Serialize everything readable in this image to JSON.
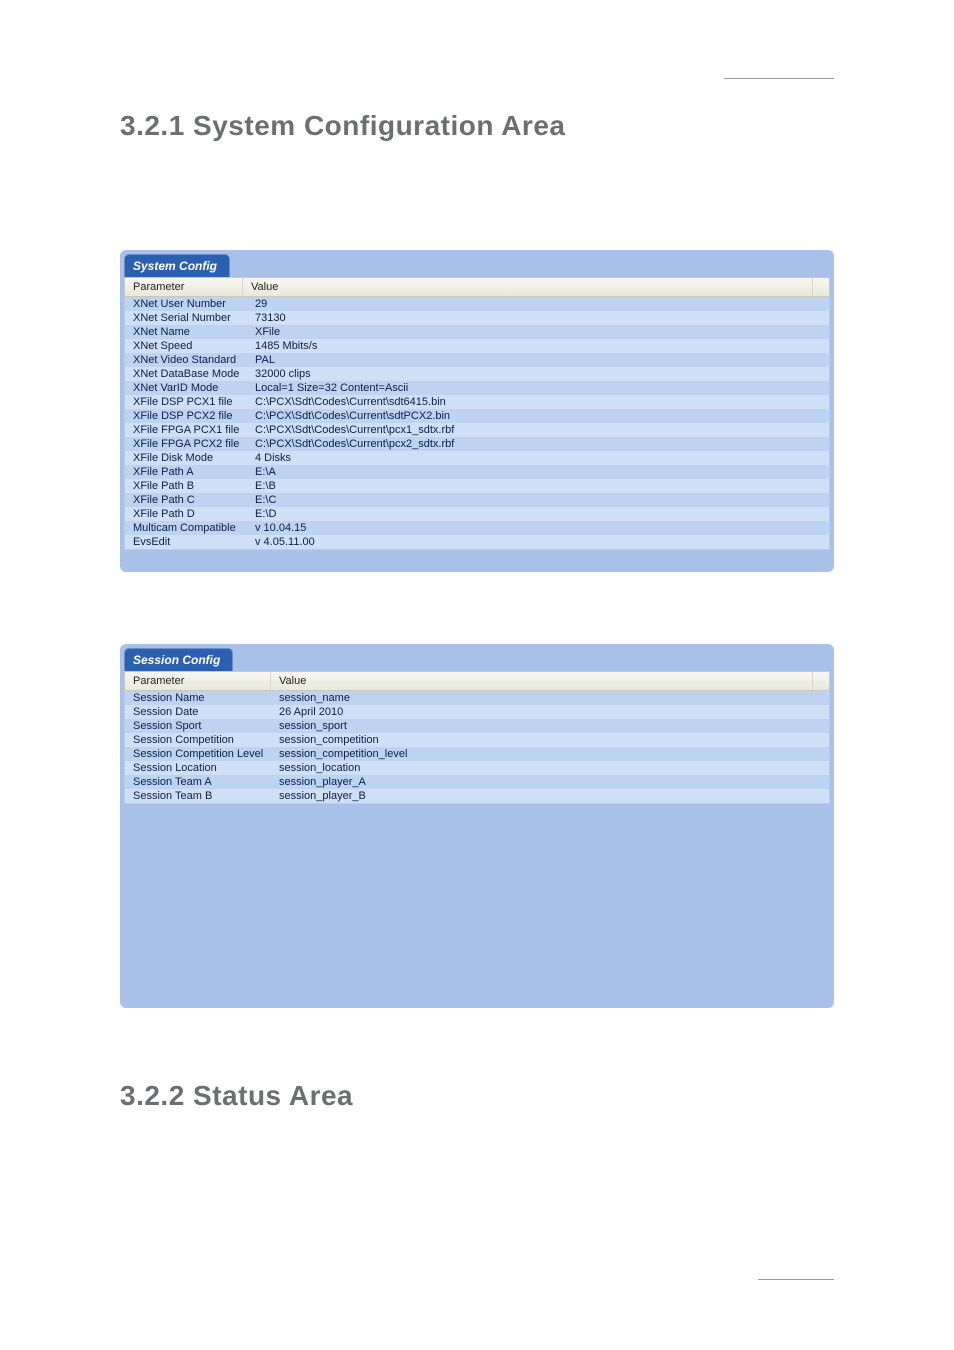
{
  "headings": {
    "system_config": "3.2.1  System  Configuration  Area",
    "status_area": "3.2.2  Status  Area"
  },
  "system_panel": {
    "tab_label": "System Config",
    "columns": {
      "param": "Parameter",
      "value": "Value"
    },
    "rows": [
      {
        "param": "XNet User Number",
        "value": "29"
      },
      {
        "param": "XNet Serial Number",
        "value": "73130"
      },
      {
        "param": "XNet Name",
        "value": "XFile"
      },
      {
        "param": "XNet Speed",
        "value": "1485 Mbits/s"
      },
      {
        "param": "XNet Video Standard",
        "value": "PAL"
      },
      {
        "param": "XNet DataBase Mode",
        "value": "32000 clips"
      },
      {
        "param": "XNet VarID Mode",
        "value": "Local=1  Size=32  Content=Ascii"
      },
      {
        "param": "XFile DSP PCX1 file",
        "value": "C:\\PCX\\Sdt\\Codes\\Current\\sdt6415.bin"
      },
      {
        "param": "XFile DSP PCX2 file",
        "value": "C:\\PCX\\Sdt\\Codes\\Current\\sdtPCX2.bin"
      },
      {
        "param": "XFile FPGA PCX1 file",
        "value": "C:\\PCX\\Sdt\\Codes\\Current\\pcx1_sdtx.rbf"
      },
      {
        "param": "XFile FPGA PCX2 file",
        "value": "C:\\PCX\\Sdt\\Codes\\Current\\pcx2_sdtx.rbf"
      },
      {
        "param": "XFile Disk Mode",
        "value": "4 Disks"
      },
      {
        "param": "XFile Path A",
        "value": "E:\\A"
      },
      {
        "param": "XFile Path B",
        "value": "E:\\B"
      },
      {
        "param": "XFile Path C",
        "value": "E:\\C"
      },
      {
        "param": "XFile Path D",
        "value": "E:\\D"
      },
      {
        "param": "Multicam Compatible",
        "value": "v 10.04.15"
      },
      {
        "param": "EvsEdit",
        "value": "v 4.05.11.00"
      }
    ]
  },
  "session_panel": {
    "tab_label": "Session Config",
    "columns": {
      "param": "Parameter",
      "value": "Value"
    },
    "rows": [
      {
        "param": "Session Name",
        "value": "session_name"
      },
      {
        "param": "Session Date",
        "value": "26 April 2010"
      },
      {
        "param": "Session Sport",
        "value": "session_sport"
      },
      {
        "param": "Session Competition",
        "value": "session_competition"
      },
      {
        "param": "Session Competition Level",
        "value": "session_competition_level"
      },
      {
        "param": "Session Location",
        "value": "session_location"
      },
      {
        "param": "Session Team A",
        "value": "session_player_A"
      },
      {
        "param": "Session Team B",
        "value": "session_player_B"
      }
    ]
  }
}
